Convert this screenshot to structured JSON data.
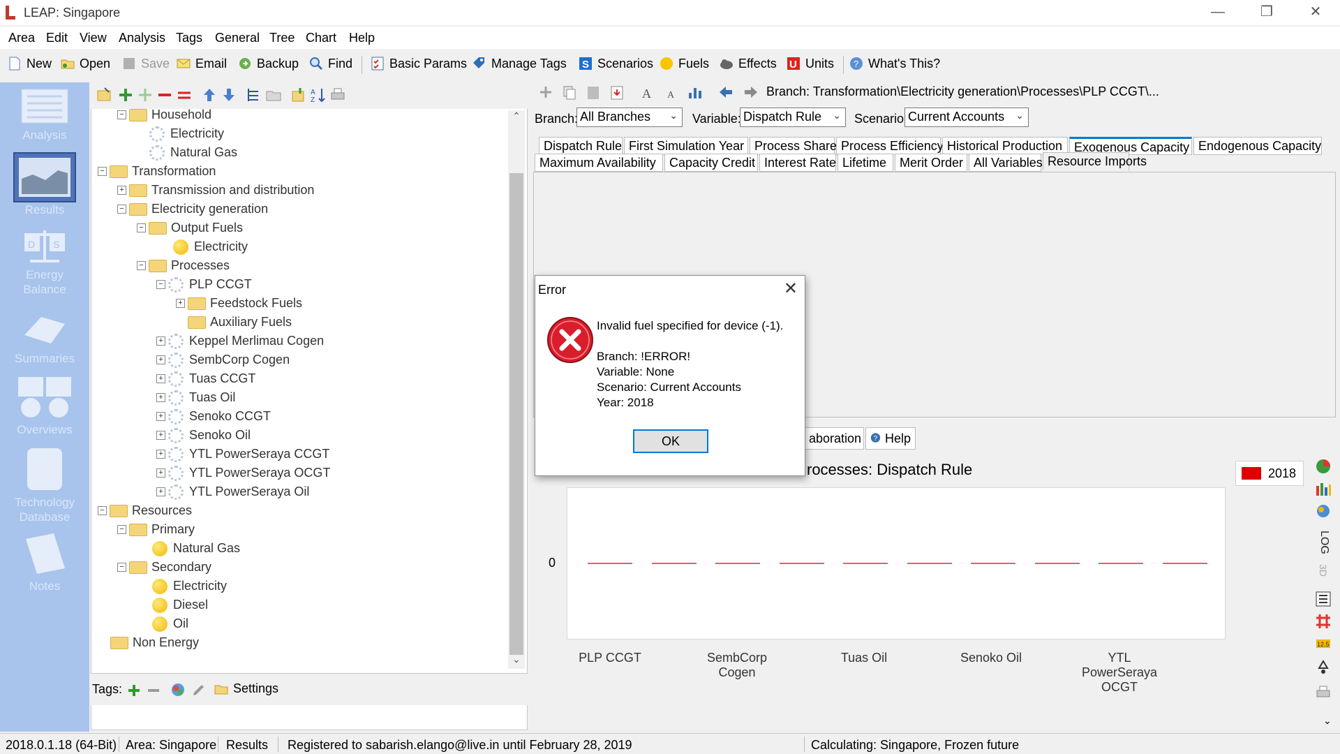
{
  "window": {
    "title": "LEAP: Singapore"
  },
  "menu": [
    "Area",
    "Edit",
    "View",
    "Analysis",
    "Tags",
    "General",
    "Tree",
    "Chart",
    "Help"
  ],
  "toolbar": {
    "new": "New",
    "open": "Open",
    "save": "Save",
    "email": "Email",
    "backup": "Backup",
    "find": "Find",
    "basic_params": "Basic Params",
    "manage_tags": "Manage Tags",
    "scenarios": "Scenarios",
    "fuels": "Fuels",
    "effects": "Effects",
    "units": "Units",
    "whats_this": "What's This?"
  },
  "sidebar": {
    "analysis": "Analysis",
    "results": "Results",
    "energy_balance": "Energy\nBalance",
    "summaries": "Summaries",
    "overviews": "Overviews",
    "tech_db": "Technology\nDatabase",
    "notes": "Notes"
  },
  "tree": [
    "Household",
    "Electricity",
    "Natural Gas",
    "Transformation",
    "Transmission and distribution",
    "Electricity generation",
    "Output Fuels",
    "Electricity",
    "Processes",
    "PLP CCGT",
    "Feedstock Fuels",
    "Auxiliary Fuels",
    "Keppel Merlimau Cogen",
    "SembCorp Cogen",
    "Tuas CCGT",
    "Tuas Oil",
    "Senoko CCGT",
    "Senoko Oil",
    "YTL PowerSeraya CCGT",
    "YTL PowerSeraya OCGT",
    "YTL PowerSeraya Oil",
    "Resources",
    "Primary",
    "Natural Gas",
    "Secondary",
    "Electricity",
    "Diesel",
    "Oil",
    "Non Energy"
  ],
  "tags": {
    "label": "Tags:",
    "settings": "Settings"
  },
  "branch_path": "Branch: Transformation\\Electricity generation\\Processes\\PLP CCGT\\...",
  "filters": {
    "branch_label": "Branch:",
    "branch_value": "All Branches",
    "variable_label": "Variable:",
    "variable_value": "Dispatch Rule",
    "scenario_label": "Scenario:",
    "scenario_value": "Current Accounts"
  },
  "tabs_row1": [
    "Dispatch Rule",
    "First Simulation Year",
    "Process Share",
    "Process Efficiency",
    "Historical Production",
    "Exogenous Capacity",
    "Endogenous Capacity"
  ],
  "tabs_row2": [
    "Maximum Availability",
    "Capacity Credit",
    "Interest Rate",
    "Lifetime",
    "Merit Order",
    "All Variables",
    "Resource Imports"
  ],
  "bottom_tabs": {
    "elaboration": "aboration",
    "help": "Help"
  },
  "chart_data": {
    "type": "bar",
    "title": "rocesses: Dispatch Rule",
    "legend": [
      "2018"
    ],
    "legend_color": "#e00000",
    "y_tick": "0",
    "x_labels": [
      "PLP CCGT",
      "SembCorp\nCogen",
      "Tuas Oil",
      "Senoko Oil",
      "YTL\nPowerSeraya OCGT"
    ],
    "values": [
      0,
      0,
      0,
      0,
      0,
      0,
      0,
      0,
      0,
      0
    ],
    "side_log": "LOG",
    "side_3d": "3D"
  },
  "status": {
    "version": "2018.0.1.18 (64-Bit)",
    "area": "Area: Singapore",
    "view": "Results",
    "registration": "Registered to sabarish.elango@live.in until February 28, 2019",
    "calculating": "Calculating: Singapore, Frozen future"
  },
  "dialog": {
    "title": "Error",
    "message": "Invalid fuel specified for device (-1).",
    "branch": "Branch: !ERROR!",
    "variable": "Variable: None",
    "scenario": "Scenario: Current Accounts",
    "year": "Year: 2018",
    "ok": "OK"
  },
  "colors": {
    "sidebar": "#a8c4ec",
    "accent": "#0078d7",
    "error": "#d81e2c",
    "series": "#e06070"
  }
}
